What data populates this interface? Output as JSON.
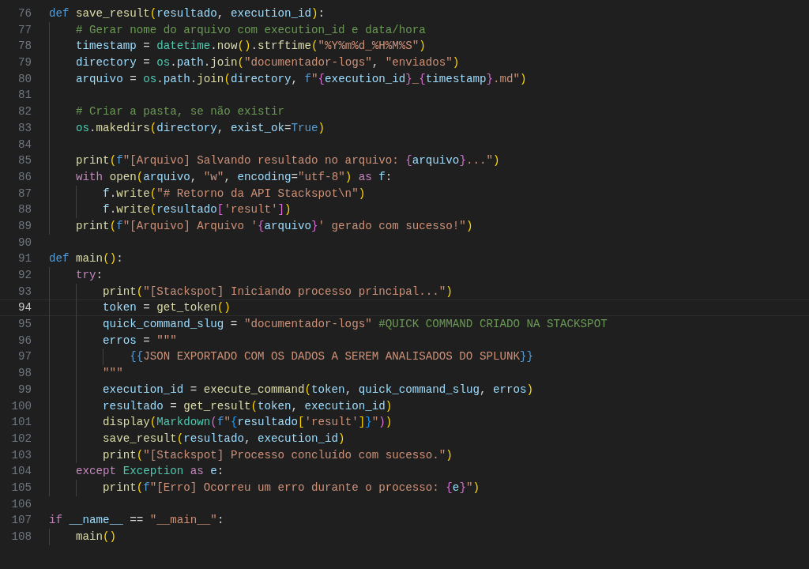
{
  "editor": {
    "lines": [
      {
        "number": "76",
        "current": false,
        "tokens": [
          {
            "kind": "kw",
            "text": "def "
          },
          {
            "kind": "fn",
            "text": "save_result"
          },
          {
            "kind": "b1",
            "text": "("
          },
          {
            "kind": "var",
            "text": "resultado"
          },
          {
            "kind": "p",
            "text": ", "
          },
          {
            "kind": "var",
            "text": "execution_id"
          },
          {
            "kind": "b1",
            "text": ")"
          },
          {
            "kind": "p",
            "text": ":"
          }
        ]
      },
      {
        "number": "77",
        "current": false,
        "tokens": [
          {
            "kind": "com",
            "text": "    # Gerar nome do arquivo com execution_id e data/hora"
          }
        ]
      },
      {
        "number": "78",
        "current": false,
        "tokens": [
          {
            "kind": "var",
            "text": "    timestamp"
          },
          {
            "kind": "p",
            "text": " = "
          },
          {
            "kind": "cls",
            "text": "datetime"
          },
          {
            "kind": "p",
            "text": "."
          },
          {
            "kind": "fn",
            "text": "now"
          },
          {
            "kind": "b1",
            "text": "()"
          },
          {
            "kind": "p",
            "text": "."
          },
          {
            "kind": "fn",
            "text": "strftime"
          },
          {
            "kind": "b1",
            "text": "("
          },
          {
            "kind": "str",
            "text": "\"%Y%m%d_%H%M%S\""
          },
          {
            "kind": "b1",
            "text": ")"
          }
        ]
      },
      {
        "number": "79",
        "current": false,
        "tokens": [
          {
            "kind": "var",
            "text": "    directory"
          },
          {
            "kind": "p",
            "text": " = "
          },
          {
            "kind": "cls",
            "text": "os"
          },
          {
            "kind": "p",
            "text": "."
          },
          {
            "kind": "var",
            "text": "path"
          },
          {
            "kind": "p",
            "text": "."
          },
          {
            "kind": "fn",
            "text": "join"
          },
          {
            "kind": "b1",
            "text": "("
          },
          {
            "kind": "str",
            "text": "\"documentador-logs\""
          },
          {
            "kind": "p",
            "text": ", "
          },
          {
            "kind": "str",
            "text": "\"enviados\""
          },
          {
            "kind": "b1",
            "text": ")"
          }
        ]
      },
      {
        "number": "80",
        "current": false,
        "tokens": [
          {
            "kind": "var",
            "text": "    arquivo"
          },
          {
            "kind": "p",
            "text": " = "
          },
          {
            "kind": "cls",
            "text": "os"
          },
          {
            "kind": "p",
            "text": "."
          },
          {
            "kind": "var",
            "text": "path"
          },
          {
            "kind": "p",
            "text": "."
          },
          {
            "kind": "fn",
            "text": "join"
          },
          {
            "kind": "b1",
            "text": "("
          },
          {
            "kind": "var",
            "text": "directory"
          },
          {
            "kind": "p",
            "text": ", "
          },
          {
            "kind": "kw",
            "text": "f"
          },
          {
            "kind": "str",
            "text": "\""
          },
          {
            "kind": "b2",
            "text": "{"
          },
          {
            "kind": "var",
            "text": "execution_id"
          },
          {
            "kind": "b2",
            "text": "}"
          },
          {
            "kind": "str",
            "text": "_"
          },
          {
            "kind": "b2",
            "text": "{"
          },
          {
            "kind": "var",
            "text": "timestamp"
          },
          {
            "kind": "b2",
            "text": "}"
          },
          {
            "kind": "str",
            "text": ".md\""
          },
          {
            "kind": "b1",
            "text": ")"
          }
        ]
      },
      {
        "number": "81",
        "current": false
      },
      {
        "number": "82",
        "current": false,
        "tokens": [
          {
            "kind": "com",
            "text": "    # Criar a pasta, se não existir"
          }
        ]
      },
      {
        "number": "83",
        "current": false,
        "tokens": [
          {
            "kind": "cls",
            "text": "    os"
          },
          {
            "kind": "p",
            "text": "."
          },
          {
            "kind": "fn",
            "text": "makedirs"
          },
          {
            "kind": "b1",
            "text": "("
          },
          {
            "kind": "var",
            "text": "directory"
          },
          {
            "kind": "p",
            "text": ", "
          },
          {
            "kind": "var",
            "text": "exist_ok"
          },
          {
            "kind": "p",
            "text": "="
          },
          {
            "kind": "kw",
            "text": "True"
          },
          {
            "kind": "b1",
            "text": ")"
          }
        ]
      },
      {
        "number": "84",
        "current": false
      },
      {
        "number": "85",
        "current": false,
        "tokens": [
          {
            "kind": "fn",
            "text": "    print"
          },
          {
            "kind": "b1",
            "text": "("
          },
          {
            "kind": "kw",
            "text": "f"
          },
          {
            "kind": "str",
            "text": "\"[Arquivo] Salvando resultado no arquivo: "
          },
          {
            "kind": "b2",
            "text": "{"
          },
          {
            "kind": "var",
            "text": "arquivo"
          },
          {
            "kind": "b2",
            "text": "}"
          },
          {
            "kind": "str",
            "text": "...\""
          },
          {
            "kind": "b1",
            "text": ")"
          }
        ]
      },
      {
        "number": "86",
        "current": false,
        "tokens": [
          {
            "kind": "ctl",
            "text": "    with "
          },
          {
            "kind": "fn",
            "text": "open"
          },
          {
            "kind": "b1",
            "text": "("
          },
          {
            "kind": "var",
            "text": "arquivo"
          },
          {
            "kind": "p",
            "text": ", "
          },
          {
            "kind": "str",
            "text": "\"w\""
          },
          {
            "kind": "p",
            "text": ", "
          },
          {
            "kind": "var",
            "text": "encoding"
          },
          {
            "kind": "p",
            "text": "="
          },
          {
            "kind": "str",
            "text": "\"utf-8\""
          },
          {
            "kind": "b1",
            "text": ")"
          },
          {
            "kind": "ctl",
            "text": " as "
          },
          {
            "kind": "var",
            "text": "f"
          },
          {
            "kind": "p",
            "text": ":"
          }
        ]
      },
      {
        "number": "87",
        "current": false,
        "tokens": [
          {
            "kind": "var",
            "text": "        f"
          },
          {
            "kind": "p",
            "text": "."
          },
          {
            "kind": "fn",
            "text": "write"
          },
          {
            "kind": "b1",
            "text": "("
          },
          {
            "kind": "str",
            "text": "\"# Retorno da API Stackspot\\n\""
          },
          {
            "kind": "b1",
            "text": ")"
          }
        ]
      },
      {
        "number": "88",
        "current": false,
        "tokens": [
          {
            "kind": "var",
            "text": "        f"
          },
          {
            "kind": "p",
            "text": "."
          },
          {
            "kind": "fn",
            "text": "write"
          },
          {
            "kind": "b1",
            "text": "("
          },
          {
            "kind": "var",
            "text": "resultado"
          },
          {
            "kind": "b2",
            "text": "["
          },
          {
            "kind": "str",
            "text": "'result'"
          },
          {
            "kind": "b2",
            "text": "]"
          },
          {
            "kind": "b1",
            "text": ")"
          }
        ]
      },
      {
        "number": "89",
        "current": false,
        "tokens": [
          {
            "kind": "fn",
            "text": "    print"
          },
          {
            "kind": "b1",
            "text": "("
          },
          {
            "kind": "kw",
            "text": "f"
          },
          {
            "kind": "str",
            "text": "\"[Arquivo] Arquivo '"
          },
          {
            "kind": "b2",
            "text": "{"
          },
          {
            "kind": "var",
            "text": "arquivo"
          },
          {
            "kind": "b2",
            "text": "}"
          },
          {
            "kind": "str",
            "text": "' gerado com sucesso!\""
          },
          {
            "kind": "b1",
            "text": ")"
          }
        ]
      },
      {
        "number": "90",
        "current": false
      },
      {
        "number": "91",
        "current": false,
        "tokens": [
          {
            "kind": "kw",
            "text": "def "
          },
          {
            "kind": "fn",
            "text": "main"
          },
          {
            "kind": "b1",
            "text": "()"
          },
          {
            "kind": "p",
            "text": ":"
          }
        ]
      },
      {
        "number": "92",
        "current": false,
        "tokens": [
          {
            "kind": "ctl",
            "text": "    try"
          },
          {
            "kind": "p",
            "text": ":"
          }
        ]
      },
      {
        "number": "93",
        "current": false,
        "tokens": [
          {
            "kind": "fn",
            "text": "        print"
          },
          {
            "kind": "b1",
            "text": "("
          },
          {
            "kind": "str",
            "text": "\"[Stackspot] Iniciando processo principal...\""
          },
          {
            "kind": "b1",
            "text": ")"
          }
        ]
      },
      {
        "number": "94",
        "current": true,
        "tokens": [
          {
            "kind": "var",
            "text": "        token"
          },
          {
            "kind": "p",
            "text": " = "
          },
          {
            "kind": "fn",
            "text": "get_token"
          },
          {
            "kind": "b1",
            "text": "()"
          }
        ]
      },
      {
        "number": "95",
        "current": false,
        "tokens": [
          {
            "kind": "var",
            "text": "        quick_command_slug"
          },
          {
            "kind": "p",
            "text": " = "
          },
          {
            "kind": "str",
            "text": "\"documentador-logs\" "
          },
          {
            "kind": "com",
            "text": "#QUICK COMMAND CRIADO NA STACKSPOT"
          }
        ]
      },
      {
        "number": "96",
        "current": false,
        "tokens": [
          {
            "kind": "var",
            "text": "        erros"
          },
          {
            "kind": "p",
            "text": " = "
          },
          {
            "kind": "str",
            "text": "\"\"\""
          }
        ]
      },
      {
        "number": "97",
        "current": false,
        "tokens": [
          {
            "kind": "esc",
            "text": "            {{"
          },
          {
            "kind": "str",
            "text": "JSON EXPORTADO COM OS DADOS A SEREM ANALISADOS DO SPLUNK"
          },
          {
            "kind": "esc",
            "text": "}}"
          }
        ]
      },
      {
        "number": "98",
        "current": false,
        "tokens": [
          {
            "kind": "str",
            "text": "        \"\"\""
          }
        ]
      },
      {
        "number": "99",
        "current": false,
        "tokens": [
          {
            "kind": "var",
            "text": "        execution_id"
          },
          {
            "kind": "p",
            "text": " = "
          },
          {
            "kind": "fn",
            "text": "execute_command"
          },
          {
            "kind": "b1",
            "text": "("
          },
          {
            "kind": "var",
            "text": "token"
          },
          {
            "kind": "p",
            "text": ", "
          },
          {
            "kind": "var",
            "text": "quick_command_slug"
          },
          {
            "kind": "p",
            "text": ", "
          },
          {
            "kind": "var",
            "text": "erros"
          },
          {
            "kind": "b1",
            "text": ")"
          }
        ]
      },
      {
        "number": "100",
        "current": false,
        "tokens": [
          {
            "kind": "var",
            "text": "        resultado"
          },
          {
            "kind": "p",
            "text": " = "
          },
          {
            "kind": "fn",
            "text": "get_result"
          },
          {
            "kind": "b1",
            "text": "("
          },
          {
            "kind": "var",
            "text": "token"
          },
          {
            "kind": "p",
            "text": ", "
          },
          {
            "kind": "var",
            "text": "execution_id"
          },
          {
            "kind": "b1",
            "text": ")"
          }
        ]
      },
      {
        "number": "101",
        "current": false,
        "tokens": [
          {
            "kind": "fn",
            "text": "        display"
          },
          {
            "kind": "b1",
            "text": "("
          },
          {
            "kind": "cls",
            "text": "Markdown"
          },
          {
            "kind": "b2",
            "text": "("
          },
          {
            "kind": "kw",
            "text": "f"
          },
          {
            "kind": "str",
            "text": "\""
          },
          {
            "kind": "b3",
            "text": "{"
          },
          {
            "kind": "var",
            "text": "resultado"
          },
          {
            "kind": "b1",
            "text": "["
          },
          {
            "kind": "str",
            "text": "'result'"
          },
          {
            "kind": "b1",
            "text": "]"
          },
          {
            "kind": "b3",
            "text": "}"
          },
          {
            "kind": "str",
            "text": "\""
          },
          {
            "kind": "b2",
            "text": ")"
          },
          {
            "kind": "b1",
            "text": ")"
          }
        ]
      },
      {
        "number": "102",
        "current": false,
        "tokens": [
          {
            "kind": "fn",
            "text": "        save_result"
          },
          {
            "kind": "b1",
            "text": "("
          },
          {
            "kind": "var",
            "text": "resultado"
          },
          {
            "kind": "p",
            "text": ", "
          },
          {
            "kind": "var",
            "text": "execution_id"
          },
          {
            "kind": "b1",
            "text": ")"
          }
        ]
      },
      {
        "number": "103",
        "current": false,
        "tokens": [
          {
            "kind": "fn",
            "text": "        print"
          },
          {
            "kind": "b1",
            "text": "("
          },
          {
            "kind": "str",
            "text": "\"[Stackspot] Processo concluído com sucesso.\""
          },
          {
            "kind": "b1",
            "text": ")"
          }
        ]
      },
      {
        "number": "104",
        "current": false,
        "tokens": [
          {
            "kind": "ctl",
            "text": "    except "
          },
          {
            "kind": "cls",
            "text": "Exception"
          },
          {
            "kind": "ctl",
            "text": " as "
          },
          {
            "kind": "var",
            "text": "e"
          },
          {
            "kind": "p",
            "text": ":"
          }
        ]
      },
      {
        "number": "105",
        "current": false,
        "tokens": [
          {
            "kind": "fn",
            "text": "        print"
          },
          {
            "kind": "b1",
            "text": "("
          },
          {
            "kind": "kw",
            "text": "f"
          },
          {
            "kind": "str",
            "text": "\"[Erro] Ocorreu um erro durante o processo: "
          },
          {
            "kind": "b2",
            "text": "{"
          },
          {
            "kind": "var",
            "text": "e"
          },
          {
            "kind": "b2",
            "text": "}"
          },
          {
            "kind": "str",
            "text": "\""
          },
          {
            "kind": "b1",
            "text": ")"
          }
        ]
      },
      {
        "number": "106",
        "current": false
      },
      {
        "number": "107",
        "current": false,
        "tokens": [
          {
            "kind": "ctl",
            "text": "if "
          },
          {
            "kind": "var",
            "text": "__name__"
          },
          {
            "kind": "p",
            "text": " == "
          },
          {
            "kind": "str",
            "text": "\"__main__\""
          },
          {
            "kind": "p",
            "text": ":"
          }
        ]
      },
      {
        "number": "108",
        "current": false,
        "tokens": [
          {
            "kind": "fn",
            "text": "    main"
          },
          {
            "kind": "b1",
            "text": "()"
          }
        ]
      }
    ]
  }
}
